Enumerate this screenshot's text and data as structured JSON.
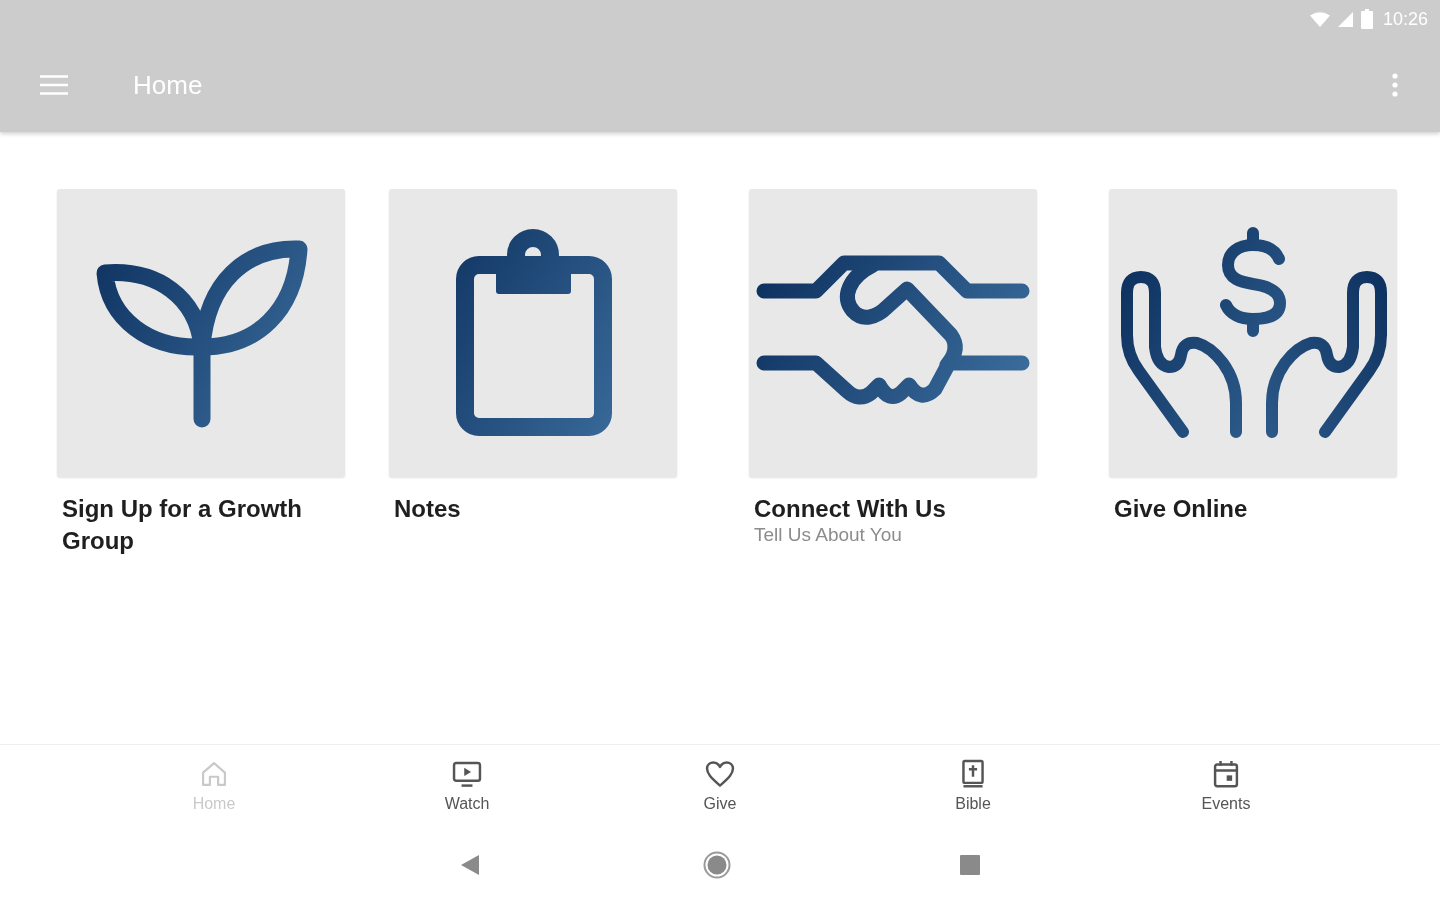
{
  "status_bar": {
    "time": "10:26"
  },
  "app_bar": {
    "title": "Home"
  },
  "tiles": [
    {
      "title": "Sign Up for a Growth Group"
    },
    {
      "title": "Notes"
    },
    {
      "title": "Connect With Us",
      "subtitle": "Tell Us About You"
    },
    {
      "title": "Give Online"
    }
  ],
  "bottom_nav": [
    {
      "label": "Home",
      "selected": true
    },
    {
      "label": "Watch",
      "selected": false
    },
    {
      "label": "Give",
      "selected": false
    },
    {
      "label": "Bible",
      "selected": false
    },
    {
      "label": "Events",
      "selected": false
    }
  ]
}
